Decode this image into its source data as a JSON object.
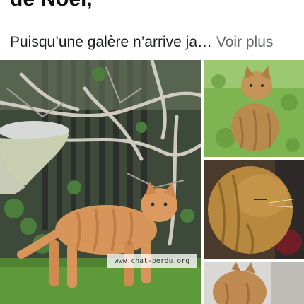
{
  "post": {
    "title": "de Noël,",
    "excerpt": "Puisqu’une galère n’arrive ja…",
    "see_more_label": "Voir plus"
  },
  "photos": {
    "main": {
      "watermark": "www.chat-perdu.org"
    }
  },
  "colors": {
    "text": "#1c1e21",
    "see_more": "#65676b",
    "cat_orange": "#d8955a",
    "grass": "#5f9a3a"
  }
}
